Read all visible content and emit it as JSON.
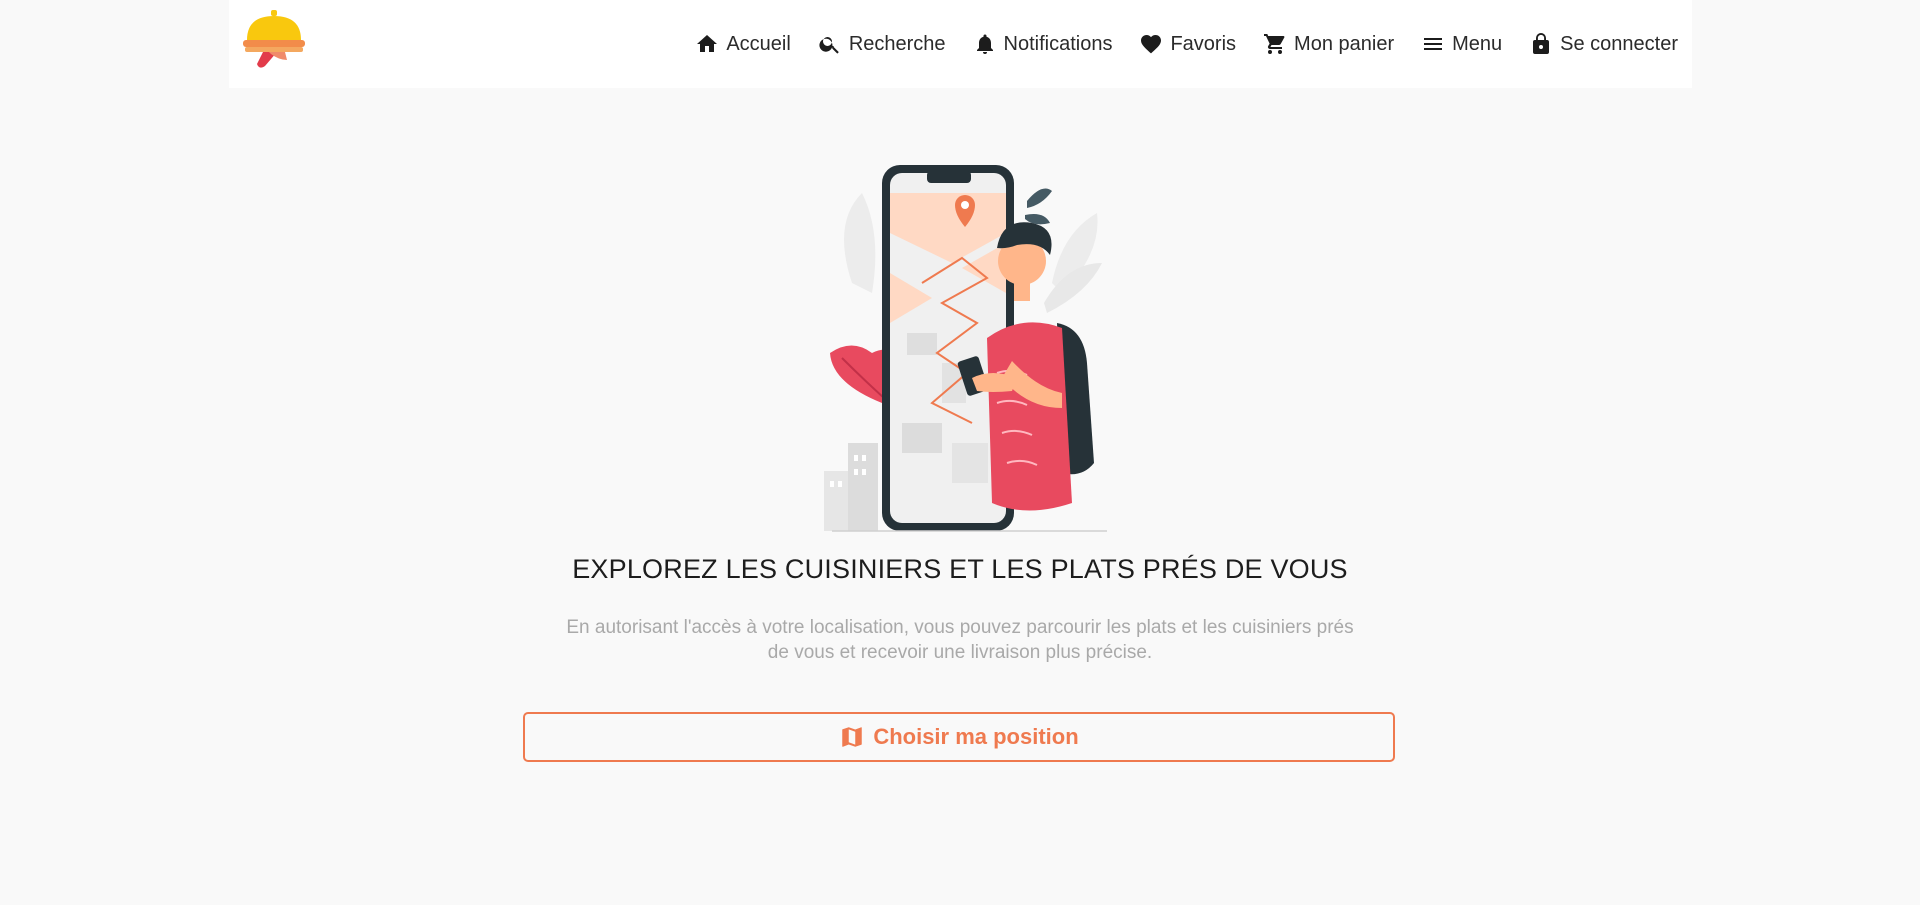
{
  "header": {
    "nav": [
      {
        "label": "Accueil",
        "icon": "home-icon"
      },
      {
        "label": "Recherche",
        "icon": "search-icon"
      },
      {
        "label": "Notifications",
        "icon": "bell-icon"
      },
      {
        "label": "Favoris",
        "icon": "heart-icon"
      },
      {
        "label": "Mon panier",
        "icon": "cart-icon"
      },
      {
        "label": "Menu",
        "icon": "menu-icon"
      },
      {
        "label": "Se connecter",
        "icon": "lock-icon"
      }
    ]
  },
  "main": {
    "headline": "EXPLOREZ LES CUISINIERS ET LES PLATS PRÉS DE VOUS",
    "description": "En autorisant l'accès à votre localisation, vous pouvez parcourir les plats et les cuisiniers prés de vous et recevoir une livraison plus précise.",
    "cta_label": "Choisir ma position",
    "cta_icon": "map-icon"
  },
  "colors": {
    "accent": "#ef7a4f",
    "logo_yellow": "#f9c80e",
    "logo_red": "#e23b4a",
    "illustration_red": "#e84a5f"
  }
}
